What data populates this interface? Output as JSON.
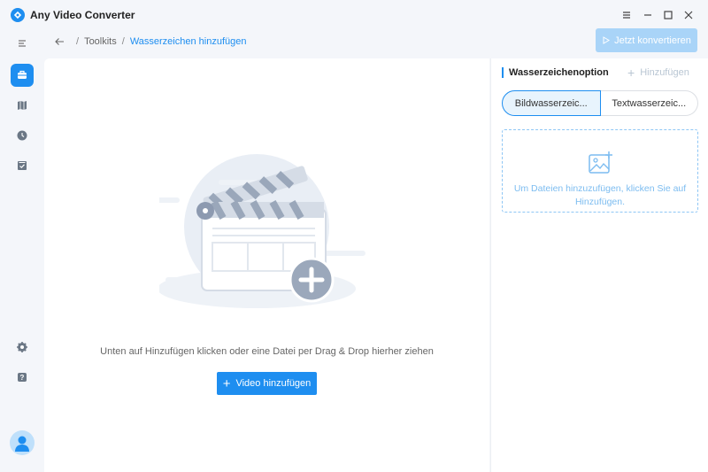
{
  "app": {
    "title": "Any Video Converter"
  },
  "breadcrumb": {
    "root": "Toolkits",
    "separator": "/",
    "current": "Wasserzeichen hinzufügen"
  },
  "toolbar": {
    "convert_label": "Jetzt konvertieren"
  },
  "main": {
    "hint": "Unten auf Hinzufügen klicken oder eine Datei per Drag & Drop hierher ziehen",
    "add_video_label": "Video hinzufügen"
  },
  "watermark_panel": {
    "title": "Wasserzeichenoption",
    "add_label": "Hinzufügen",
    "tabs": [
      {
        "label": "Bildwasserzeic...",
        "active": true
      },
      {
        "label": "Textwasserzeic...",
        "active": false
      }
    ],
    "dropzone_text": "Um Dateien hinzuzufügen, klicken Sie auf Hinzufügen."
  },
  "sidebar": {
    "items": [
      {
        "icon": "toolbox-icon",
        "active": true
      },
      {
        "icon": "map-icon",
        "active": false
      },
      {
        "icon": "clock-icon",
        "active": false
      },
      {
        "icon": "checklist-icon",
        "active": false
      },
      {
        "icon": "gear-icon",
        "active": false
      },
      {
        "icon": "help-icon",
        "active": false
      }
    ]
  },
  "colors": {
    "accent": "#1e8ef0",
    "disabled_accent": "#a9d4f8",
    "background": "#f4f6fa"
  }
}
